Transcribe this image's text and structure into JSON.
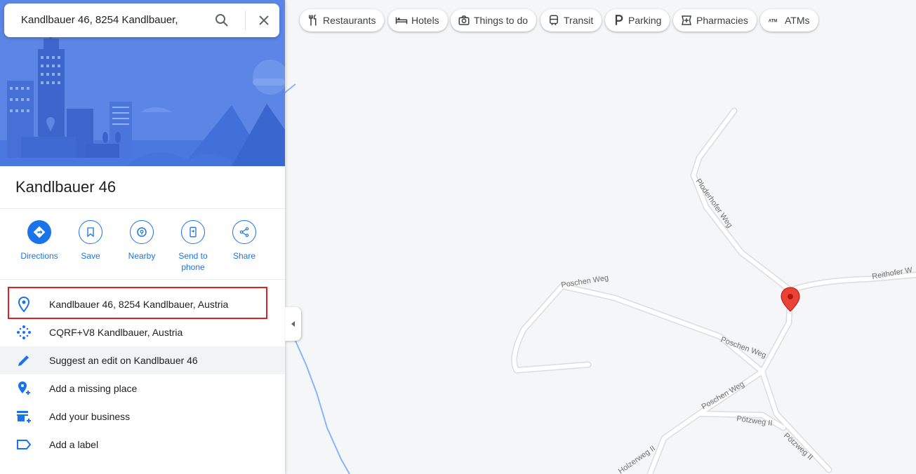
{
  "search": {
    "query": "Kandlbauer 46, 8254 Kandlbauer,"
  },
  "place": {
    "title": "Kandlbauer 46"
  },
  "actions": [
    {
      "label": "Directions",
      "icon": "directions-icon"
    },
    {
      "label": "Save",
      "icon": "bookmark-icon"
    },
    {
      "label": "Nearby",
      "icon": "nearby-icon"
    },
    {
      "label": "Send to phone",
      "icon": "send-to-phone-icon"
    },
    {
      "label": "Share",
      "icon": "share-icon"
    }
  ],
  "details": [
    {
      "text": "Kandlbauer 46, 8254 Kandlbauer, Austria",
      "icon": "location-pin-icon"
    },
    {
      "text": "CQRF+V8 Kandlbauer, Austria",
      "icon": "plus-code-icon"
    },
    {
      "text": "Suggest an edit on Kandlbauer 46",
      "icon": "pencil-icon"
    },
    {
      "text": "Add a missing place",
      "icon": "add-place-icon"
    },
    {
      "text": "Add your business",
      "icon": "add-business-icon"
    },
    {
      "text": "Add a label",
      "icon": "label-icon"
    }
  ],
  "chips": [
    {
      "label": "Restaurants",
      "icon": "restaurant-icon"
    },
    {
      "label": "Hotels",
      "icon": "hotel-icon"
    },
    {
      "label": "Things to do",
      "icon": "camera-icon"
    },
    {
      "label": "Transit",
      "icon": "transit-icon"
    },
    {
      "label": "Parking",
      "icon": "parking-icon"
    },
    {
      "label": "Pharmacies",
      "icon": "pharmacy-icon"
    },
    {
      "label": "ATMs",
      "icon": "atm-icon"
    }
  ],
  "map": {
    "road_labels": {
      "ploderhofer": "Ploderhofer Weg",
      "reithofer": "Reithofer W",
      "poschen_1": "Poschen Weg",
      "poschen_2": "Poschen Weg",
      "poschen_3": "Poschen Weg",
      "poetzweg_1": "Pötzweg II",
      "poetzweg_2": "Pötzweg II",
      "holzerweg": "Holzerweg II"
    },
    "marker_color": "#ea4335"
  },
  "colors": {
    "accent": "#1a73e8",
    "hero": "#5b86e5",
    "highlight_box": "#e02020"
  }
}
